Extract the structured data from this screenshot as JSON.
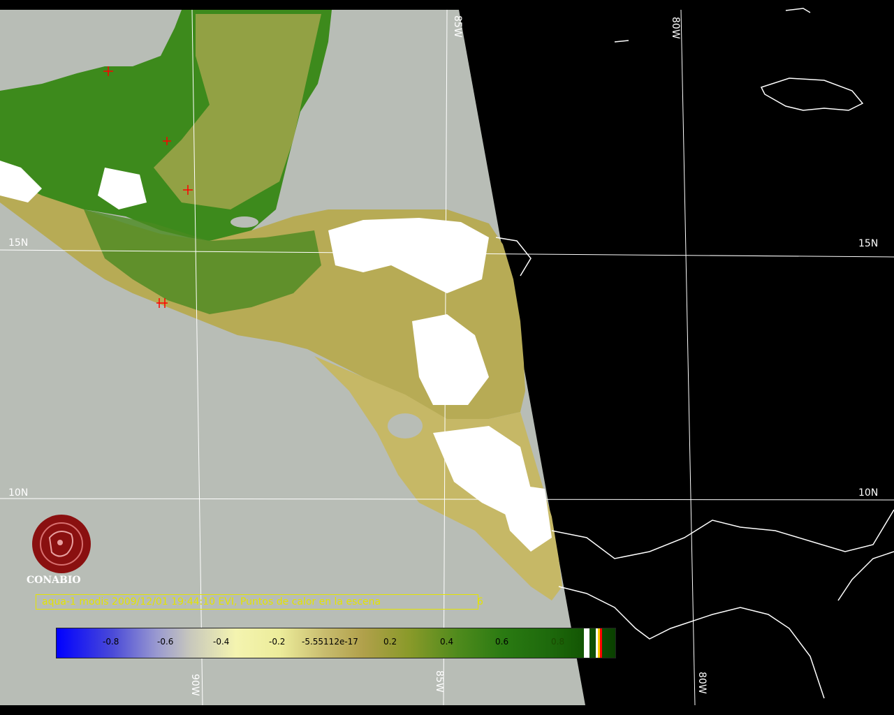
{
  "map": {
    "lon_labels_top": [
      "85W",
      "80W"
    ],
    "lon_labels_bottom": [
      "90W",
      "85W",
      "80W"
    ],
    "lat_labels_left": [
      "15N",
      "10N"
    ],
    "lat_labels_right": [
      "15N",
      "10N"
    ]
  },
  "logo": {
    "text": "CONABIO"
  },
  "caption": {
    "text": "aqua-1 modis 2009/12/01 19:44:10 EVI, Puntos de calor en la escena",
    "count": "6"
  },
  "colorbar": {
    "ticks": [
      "-0.8",
      "-0.6",
      "-0.4",
      "-0.2",
      "-5.55112e-17",
      "0.2",
      "0.4",
      "0.6",
      "0.8"
    ]
  },
  "colors": {
    "ocean_scene": "#b8bdb6",
    "outside_scene": "#000000",
    "vegetation_dark": "#2e7a12",
    "vegetation_light": "#c8b864",
    "clouds": "#ffffff",
    "hotspot": "#ff0000",
    "caption": "#e4e400",
    "logo": "#8a1010"
  }
}
